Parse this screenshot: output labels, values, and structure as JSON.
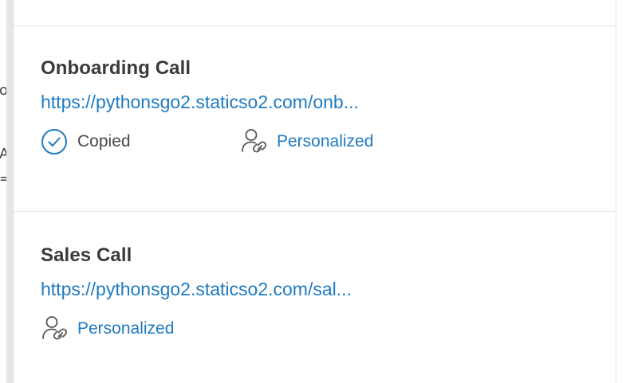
{
  "background": {
    "fragments": [
      "ou",
      "A",
      "=I"
    ]
  },
  "cards": [
    {
      "title": "Onboarding Call",
      "url": "https://pythonsgo2.staticso2.com/onb...",
      "copied_label": "Copied",
      "personalized_label": "Personalized"
    },
    {
      "title": "Sales Call",
      "url": "https://pythonsgo2.staticso2.com/sal...",
      "personalized_label": "Personalized"
    }
  ],
  "colors": {
    "link": "#1f7bc1",
    "title": "#3a3a3a",
    "divider": "#e3e3e3"
  },
  "icons": {
    "copied": "check-circle-icon",
    "personalized": "person-link-icon"
  }
}
